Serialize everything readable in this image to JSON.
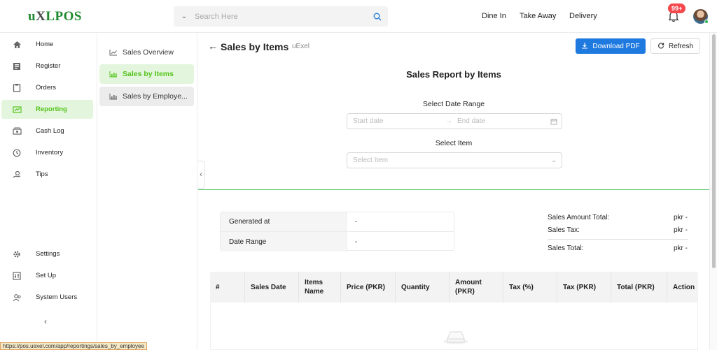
{
  "app": {
    "logo_prefix": "u",
    "logo_x": "X",
    "logo_suffix": "LPOS"
  },
  "search": {
    "placeholder": "Search Here"
  },
  "topnav": {
    "dine_in": "Dine In",
    "take_away": "Take Away",
    "delivery": "Delivery",
    "notifications_badge": "99+"
  },
  "sidebar": {
    "items": [
      {
        "label": "Home",
        "icon": "home-icon"
      },
      {
        "label": "Register",
        "icon": "register-icon"
      },
      {
        "label": "Orders",
        "icon": "orders-icon"
      },
      {
        "label": "Reporting",
        "icon": "reporting-icon",
        "active": true
      },
      {
        "label": "Cash Log",
        "icon": "cash-log-icon"
      },
      {
        "label": "Inventory",
        "icon": "inventory-icon"
      },
      {
        "label": "Tips",
        "icon": "tips-icon"
      },
      {
        "label": "Settings",
        "icon": "gear-icon"
      },
      {
        "label": "Set Up",
        "icon": "setup-icon"
      },
      {
        "label": "System Users",
        "icon": "users-icon"
      }
    ]
  },
  "submenu": {
    "items": [
      {
        "label": "Sales Overview"
      },
      {
        "label": "Sales by Items",
        "active": true
      },
      {
        "label": "Sales by Employe..."
      }
    ]
  },
  "page": {
    "title": "Sales by Items",
    "subtitle": "uExel",
    "download_pdf": "Download PDF",
    "refresh": "Refresh",
    "report_title": "Sales Report by Items",
    "date_range_label": "Select Date Range",
    "start_placeholder": "Start date",
    "end_placeholder": "End date",
    "item_label": "Select Item",
    "item_placeholder": "Select Item"
  },
  "meta": {
    "generated_at_label": "Generated at",
    "generated_at_value": "-",
    "date_range_label": "Date Range",
    "date_range_value": "-"
  },
  "totals": {
    "sales_amount_label": "Sales Amount Total:",
    "sales_amount_value": "pkr -",
    "sales_tax_label": "Sales Tax:",
    "sales_tax_value": "pkr -",
    "sales_total_label": "Sales Total:",
    "sales_total_value": "pkr -"
  },
  "table": {
    "columns": [
      "#",
      "Sales Date",
      "Items Name",
      "Price (PKR)",
      "Quantity",
      "Amount (PKR)",
      "Tax (%)",
      "Tax (PKR)",
      "Total (PKR)",
      "Action"
    ]
  },
  "status_bar": {
    "url": "https://pos.uexel.com/app/reportings/sales_by_employee"
  },
  "colors": {
    "accent_green": "#52c41a",
    "primary_blue": "#1f7ae0",
    "badge_red": "#f5474c"
  }
}
